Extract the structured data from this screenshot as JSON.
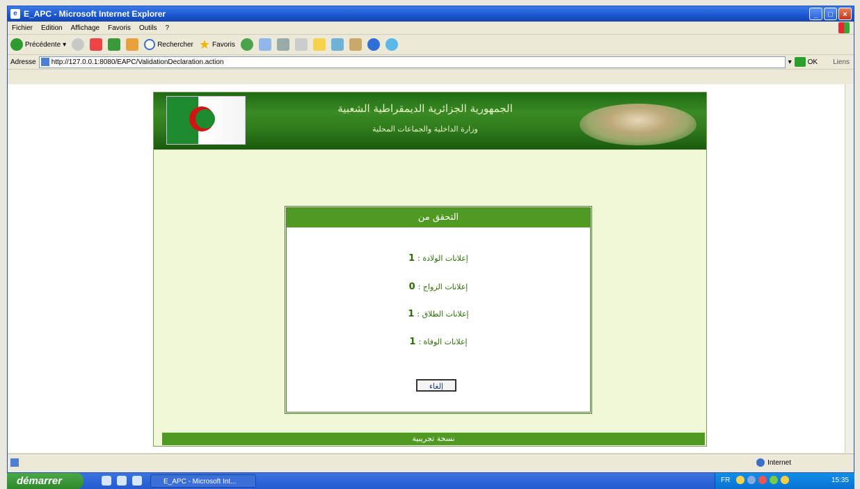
{
  "browser": {
    "title": "E_APC - Microsoft Internet Explorer",
    "menu": [
      "Fichier",
      "Edition",
      "Affichage",
      "Favoris",
      "Outils",
      "?"
    ],
    "toolbar": {
      "back": "Précédente",
      "search": "Rechercher",
      "favorites": "Favoris"
    },
    "address_label": "Adresse",
    "url": "http://127.0.0.1:8080/EAPC/ValidationDeclaration.action",
    "go": "OK",
    "links": "Liens",
    "status_zone": "Internet"
  },
  "page": {
    "header_line1": "الجمهورية الجزائرية الديمقراطية الشعبية",
    "header_line2": "وزارة الداخلية والجماعات المحلية",
    "panel_title": "التحقق من",
    "rows": [
      {
        "label": "إعلانات الولادة :",
        "value": "1"
      },
      {
        "label": "إعلانات الزواج :",
        "value": "0"
      },
      {
        "label": "إعلانات الطلاق :",
        "value": "1"
      },
      {
        "label": "إعلانات الوفاة :",
        "value": "1"
      }
    ],
    "cancel_button": "إلغاء",
    "footer": "نسخة تجريبية"
  },
  "taskbar": {
    "start": "démarrer",
    "task": "E_APC - Microsoft Int...",
    "lang": "FR",
    "clock": "15:35"
  }
}
